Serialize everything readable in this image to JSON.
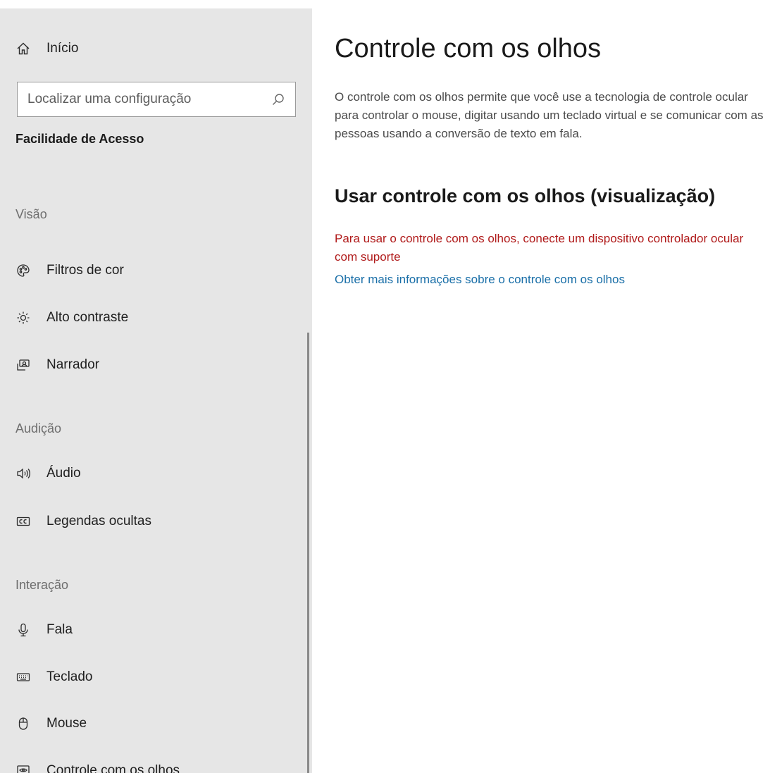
{
  "sidebar": {
    "home_label": "Início",
    "search": {
      "placeholder": "Localizar uma configuração",
      "value": ""
    },
    "category_title": "Facilidade de Acesso",
    "sections": {
      "vision": {
        "heading": "Visão",
        "items": [
          {
            "label": "Filtros de cor",
            "icon": "color-filter-icon"
          },
          {
            "label": "Alto contraste",
            "icon": "brightness-icon"
          },
          {
            "label": "Narrador",
            "icon": "narrator-icon"
          }
        ]
      },
      "hearing": {
        "heading": "Audição",
        "items": [
          {
            "label": "Áudio",
            "icon": "speaker-icon"
          },
          {
            "label": "Legendas ocultas",
            "icon": "closed-captions-icon"
          }
        ]
      },
      "interaction": {
        "heading": "Interação",
        "items": [
          {
            "label": "Fala",
            "icon": "microphone-icon"
          },
          {
            "label": "Teclado",
            "icon": "keyboard-icon"
          },
          {
            "label": "Mouse",
            "icon": "mouse-icon"
          },
          {
            "label": "Controle com os olhos",
            "icon": "eye-control-icon"
          }
        ]
      }
    }
  },
  "main": {
    "title": "Controle com os olhos",
    "description": "O controle com os olhos permite que você use a tecnologia de controle ocular para controlar o mouse, digitar usando um teclado virtual e se comunicar com as pessoas usando a conversão de texto em fala.",
    "subheading": "Usar controle com os olhos (visualização)",
    "warning": "Para usar o controle com os olhos, conecte um dispositivo controlador ocular com suporte",
    "link": "Obter mais informações sobre o controle com os olhos"
  },
  "colors": {
    "sidebar_bg": "#e6e6e6",
    "warning": "#b01a1a",
    "link": "#1a6fa8"
  }
}
